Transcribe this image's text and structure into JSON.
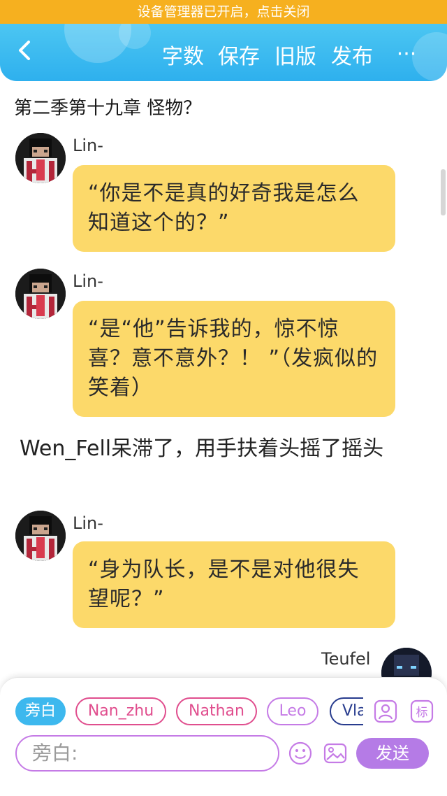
{
  "status_banner": {
    "text": "设备管理器已开启，点击关闭"
  },
  "topbar": {
    "actions": [
      {
        "label": "字数"
      },
      {
        "label": "保存"
      },
      {
        "label": "旧版"
      },
      {
        "label": "发布"
      }
    ],
    "more_label": "···"
  },
  "chapter": {
    "title": "第二季第十九章 怪物？"
  },
  "messages": [
    {
      "name": "Lin-",
      "text": "“你是不是真的好奇我是怎么知道这个的？”"
    },
    {
      "name": "Lin-",
      "text": "“是“他”告诉我的，惊不惊喜？意不意外？！ ”（发疯似的笑着）"
    },
    {
      "name": "Lin-",
      "text": "“身为队长，是不是对他很失望呢？”"
    }
  ],
  "narration": {
    "text": "Wen_Fell呆滞了，用手扶着头摇了摇头"
  },
  "partial_message": {
    "name": "Teufel"
  },
  "composer": {
    "roles": [
      {
        "label": "旁白"
      },
      {
        "label": "Nan_zhu"
      },
      {
        "label": "Nathan"
      },
      {
        "label": "Leo"
      },
      {
        "label": "Vla"
      }
    ],
    "input_placeholder": "旁白:",
    "send_label": "发送",
    "tool_icons": [
      "role-manage-icon",
      "tag-icon",
      "emoji-icon",
      "image-icon"
    ]
  },
  "colors": {
    "banner": "#f6b01f",
    "topbar": "#2eb0ee",
    "bubble": "#fcd96a",
    "send": "#b57be6",
    "role_pink": "#e04e8e"
  }
}
